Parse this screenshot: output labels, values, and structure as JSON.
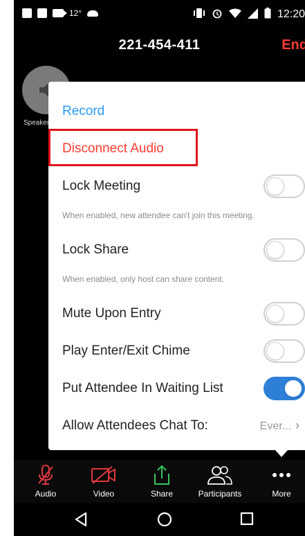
{
  "status_bar": {
    "temperature": "12°",
    "time": "12:20"
  },
  "header": {
    "meeting_id": "221-454-411",
    "end_label": "End"
  },
  "speaker": {
    "label": "Speaker"
  },
  "menu": {
    "record": "Record",
    "disconnect_audio": "Disconnect Audio",
    "lock_meeting": {
      "label": "Lock Meeting",
      "enabled": false,
      "description": "When enabled, new attendee can't join this meeting."
    },
    "lock_share": {
      "label": "Lock Share",
      "enabled": false,
      "description": "When enabled, only host can share content."
    },
    "mute_upon_entry": {
      "label": "Mute Upon Entry",
      "enabled": false
    },
    "play_chime": {
      "label": "Play Enter/Exit Chime",
      "enabled": false
    },
    "waiting_list": {
      "label": "Put Attendee In Waiting List",
      "enabled": true
    },
    "allow_chat": {
      "label": "Allow Attendees Chat To:",
      "value": "Ever..."
    }
  },
  "toolbar": {
    "audio": "Audio",
    "video": "Video",
    "share": "Share",
    "participants": "Participants",
    "more": "More"
  },
  "colors": {
    "accent_blue": "#2b9af3",
    "danger_red": "#ff3b30",
    "toggle_on": "#2e7fd8",
    "share_green": "#34c759",
    "muted_red": "#e0393e"
  }
}
